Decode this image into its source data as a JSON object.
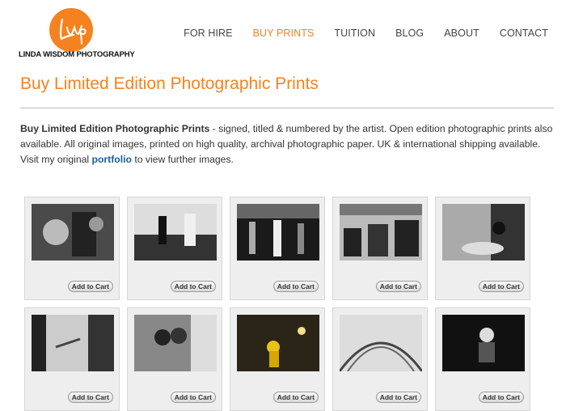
{
  "logo": {
    "monogram": "Lwp",
    "name": "LINDA WISDOM PHOTOGRAPHY"
  },
  "nav": [
    {
      "label": "FOR HIRE",
      "active": false
    },
    {
      "label": "BUY PRINTS",
      "active": true
    },
    {
      "label": "TUITION",
      "active": false
    },
    {
      "label": "BLOG",
      "active": false
    },
    {
      "label": "ABOUT",
      "active": false
    },
    {
      "label": "CONTACT",
      "active": false
    }
  ],
  "page": {
    "title": "Buy Limited Edition Photographic Prints",
    "intro_bold": "Buy Limited Edition Photographic Prints",
    "intro_text": " - signed, titled & numbered by the artist. Open edition photographic prints also available. All original images, printed on high quality, archival photographic paper. UK & international shipping available. Visit my original ",
    "intro_link": "portfolio",
    "intro_tail": " to view further images."
  },
  "products": [
    {
      "cart_label": "Add to Cart",
      "tone": "#6a6a6a"
    },
    {
      "cart_label": "Add to Cart",
      "tone": "#555"
    },
    {
      "cart_label": "Add to Cart",
      "tone": "#3a3a3a"
    },
    {
      "cart_label": "Add to Cart",
      "tone": "#888"
    },
    {
      "cart_label": "Add to Cart",
      "tone": "#5a5a5a"
    },
    {
      "cart_label": "Add to Cart",
      "tone": "#777"
    },
    {
      "cart_label": "Add to Cart",
      "tone": "#666"
    },
    {
      "cart_label": "Add to Cart",
      "tone": "#2b2b1a"
    },
    {
      "cart_label": "Add to Cart",
      "tone": "#999"
    },
    {
      "cart_label": "Add to Cart",
      "tone": "#333"
    }
  ],
  "colors": {
    "accent": "#f58220",
    "link": "#1a5f9e"
  }
}
